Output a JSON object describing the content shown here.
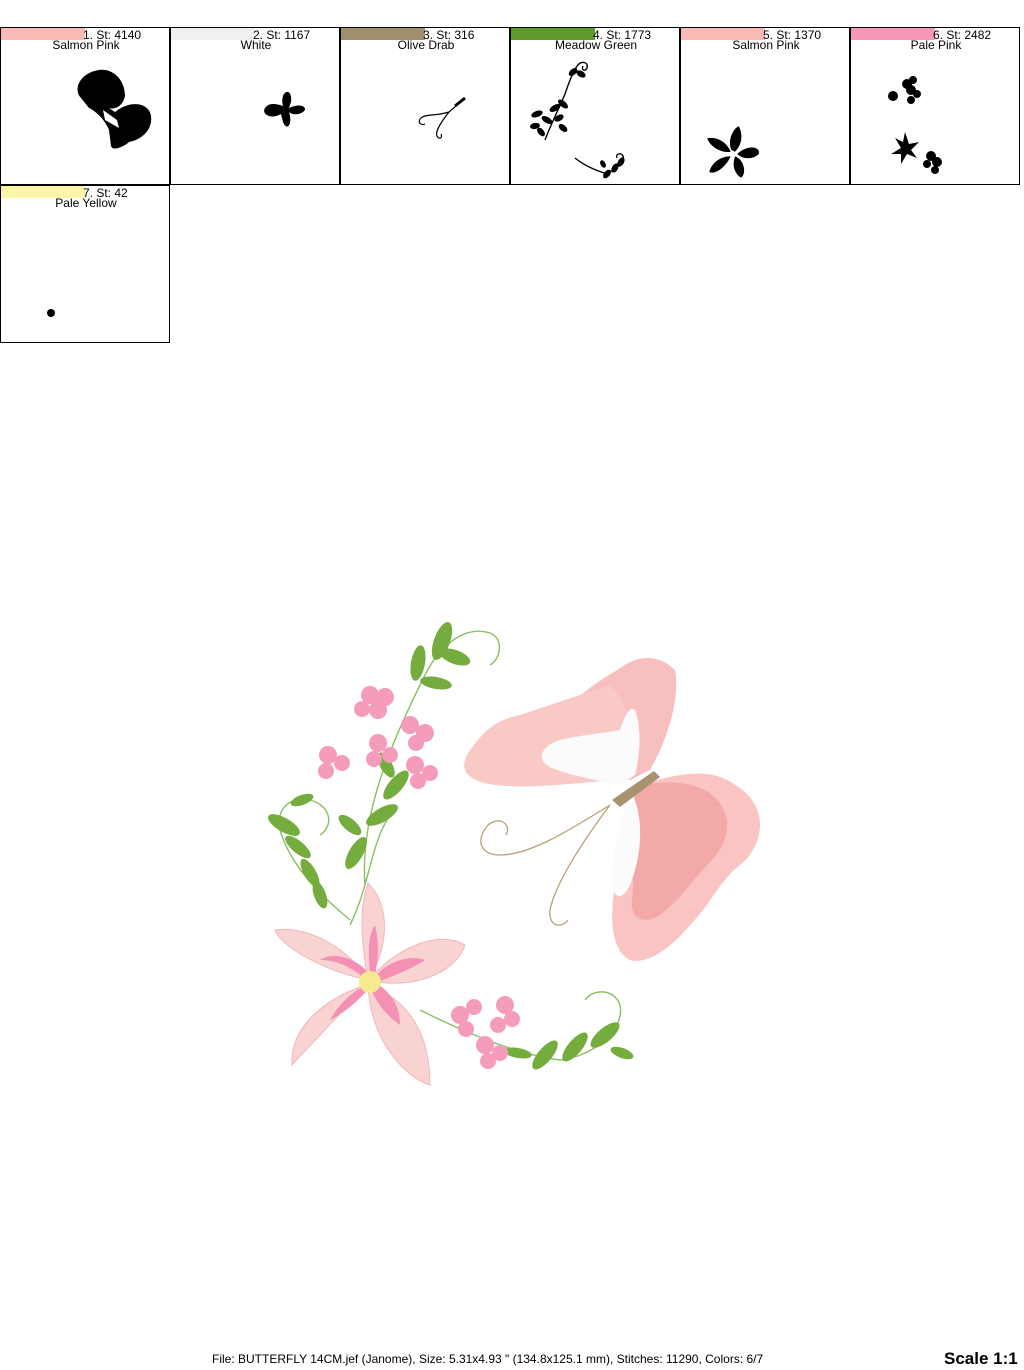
{
  "color_blocks": [
    {
      "index_stitch": "1. St: 4140",
      "name": "Salmon Pink",
      "color": "#f9b9b4"
    },
    {
      "index_stitch": "2. St: 1167",
      "name": "White",
      "color": "#f0f0f0"
    },
    {
      "index_stitch": "3. St: 316",
      "name": "Olive Drab",
      "color": "#a08f6c"
    },
    {
      "index_stitch": "4. St: 1773",
      "name": "Meadow Green",
      "color": "#5f9a2c"
    },
    {
      "index_stitch": "5. St: 1370",
      "name": "Salmon Pink",
      "color": "#f9b9b4"
    },
    {
      "index_stitch": "6. St: 2482",
      "name": "Pale Pink",
      "color": "#f799b6"
    },
    {
      "index_stitch": "7. St: 42",
      "name": "Pale Yellow",
      "color": "#fdf4a8"
    }
  ],
  "footer": {
    "file_info": "File: BUTTERFLY 14CM.jef (Janome), Size: 5.31x4.93 \" (134.8x125.1 mm), Stitches: 11290, Colors: 6/7",
    "scale": "Scale 1:1"
  }
}
